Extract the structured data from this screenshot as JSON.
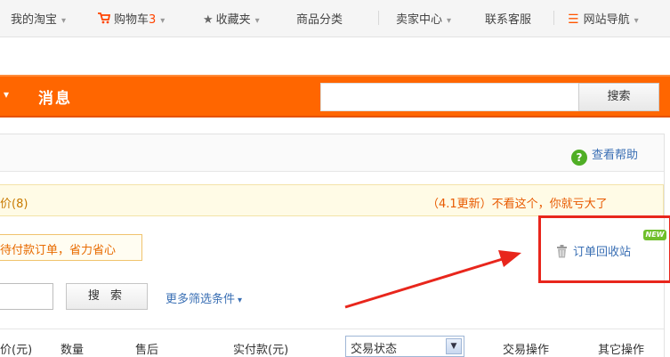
{
  "topnav": {
    "my_taobao": "我的淘宝",
    "cart_label": "购物车",
    "cart_count": "3",
    "favorites": "收藏夹",
    "categories": "商品分类",
    "seller_center": "卖家中心",
    "contact_service": "联系客服",
    "site_nav": "网站导航"
  },
  "header": {
    "title": "消息",
    "search_button": "搜索",
    "search_value": ""
  },
  "panel": {
    "help_link": "查看帮助",
    "notice_left": "价(8)",
    "notice_right": "（4.1更新）不看这个，你就亏大了",
    "promo_text": "待付款订单，省力省心",
    "recycle_link": "订单回收站",
    "new_badge": "NEW"
  },
  "filter": {
    "input_value": "",
    "search_button": "搜 索",
    "more_conditions": "更多筛选条件"
  },
  "table_header": {
    "columns": [
      "价(元)",
      "数量",
      "售后",
      "实付款(元)",
      "交易状态",
      "交易操作",
      "其它操作"
    ]
  },
  "colors": {
    "brand_orange": "#ff6600",
    "link_blue": "#3a6fb4",
    "highlight_red": "#e8261c"
  }
}
